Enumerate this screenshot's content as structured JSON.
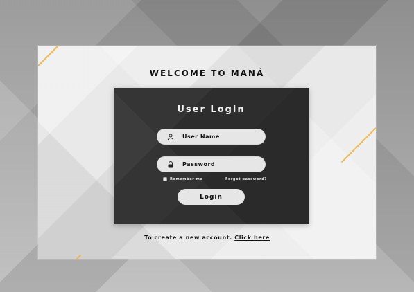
{
  "app": {
    "welcome_title": "WELCOME TO MANÁ"
  },
  "login_card": {
    "title": "User Login",
    "username_placeholder": "User Name",
    "password_placeholder": "Password",
    "remember_label": "Remember me",
    "forgot_label": "Forgot password?",
    "login_label": "Login"
  },
  "footer": {
    "create_text": "To create a new account.",
    "create_link": "Click here"
  },
  "icons": {
    "user": "user-icon",
    "lock": "lock-icon",
    "checkbox": "checkbox-icon"
  },
  "colors": {
    "card_bg": "#2d2d2d",
    "pill_bg": "#e6e6e6",
    "accent_gold": "#f0b43a"
  }
}
